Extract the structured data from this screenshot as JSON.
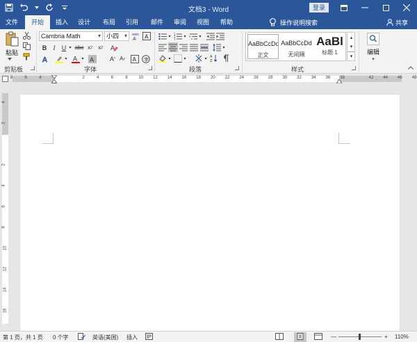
{
  "window": {
    "title": "文档3  -  Word",
    "login_label": "登录"
  },
  "tabs": [
    "文件",
    "开始",
    "插入",
    "设计",
    "布局",
    "引用",
    "邮件",
    "审阅",
    "视图",
    "帮助"
  ],
  "tell_me": "操作说明搜索",
  "share": "共享",
  "ribbon": {
    "clipboard": {
      "paste": "粘贴",
      "label": "剪贴板"
    },
    "font": {
      "family": "Cambria Math",
      "size": "小四",
      "label": "字体"
    },
    "paragraph": {
      "label": "段落"
    },
    "styles": {
      "label": "样式",
      "items": [
        {
          "sample": "AaBbCcDd",
          "name": "正文"
        },
        {
          "sample": "AaBbCcDd",
          "name": "无间隔"
        },
        {
          "sample": "AaBl",
          "name": "标题 1"
        }
      ]
    },
    "editing": {
      "label": "编辑"
    }
  },
  "ruler": {
    "h_labels": [
      "8",
      "6",
      "4",
      "2",
      "",
      "2",
      "4",
      "6",
      "8",
      "10",
      "12",
      "14",
      "16",
      "18",
      "20",
      "22",
      "24",
      "26",
      "28",
      "30",
      "32",
      "34",
      "36",
      "38",
      "",
      "42",
      "44",
      "46",
      "48"
    ],
    "v_labels": [
      "4",
      "2",
      "",
      "2",
      "4",
      "6",
      "8",
      "10",
      "12",
      "14",
      "16"
    ]
  },
  "status": {
    "page": "第 1 页，共 1 页",
    "words": "0 个字",
    "language": "英语(美国)",
    "mode": "插入",
    "zoom": "110%"
  },
  "colors": {
    "accent": "#2b579a",
    "highlight": "#ffff00",
    "font_color": "#ff0000"
  }
}
